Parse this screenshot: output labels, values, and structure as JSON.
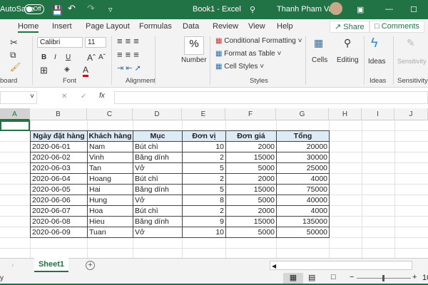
{
  "titlebar": {
    "autosave": "AutoSave",
    "toggle": "Off",
    "title": "Book1  -  Excel",
    "user": "Thanh Pham Van"
  },
  "tabs": [
    "Home",
    "Insert",
    "Page Layout",
    "Formulas",
    "Data",
    "Review",
    "View",
    "Help"
  ],
  "share": "Share",
  "comments": "Comments",
  "ribbon": {
    "font_name": "Calibri",
    "font_size": "11",
    "bold": "B",
    "italic": "I",
    "underline": "U",
    "grow": "Aˆ",
    "shrink": "Aˇ",
    "number": "Number",
    "number_icon": "%",
    "cond": "Conditional Formatting",
    "fmt_table": "Format as Table",
    "cell_styles": "Cell Styles",
    "cells": "Cells",
    "editing": "Editing",
    "ideas": "Ideas",
    "sensitivity": "Sensitivity",
    "groups": {
      "clipboard": "board",
      "font": "Font",
      "alignment": "Alignment",
      "styles": "Styles",
      "ideas": "Ideas",
      "sensitivity": "Sensitivity"
    }
  },
  "formula": {
    "cancel": "✕",
    "enter": "✓",
    "fx": "fx"
  },
  "columns": [
    "A",
    "B",
    "C",
    "D",
    "E",
    "F",
    "G",
    "H",
    "I",
    "J"
  ],
  "table": {
    "headers": [
      "Ngày đặt hàng",
      "Khách hàng",
      "Mục",
      "Đơn vị",
      "Đơn giá",
      "Tổng"
    ],
    "rows": [
      [
        "2020-06-01",
        "Nam",
        "Bút chì",
        "10",
        "2000",
        "20000"
      ],
      [
        "2020-06-02",
        "Vinh",
        "Băng dính",
        "2",
        "15000",
        "30000"
      ],
      [
        "2020-06-03",
        "Tan",
        "Vở",
        "5",
        "5000",
        "25000"
      ],
      [
        "2020-06-04",
        "Hoang",
        "Bút chì",
        "2",
        "2000",
        "4000"
      ],
      [
        "2020-06-05",
        "Hai",
        "Băng dính",
        "5",
        "15000",
        "75000"
      ],
      [
        "2020-06-06",
        "Hung",
        "Vở",
        "8",
        "5000",
        "40000"
      ],
      [
        "2020-06-07",
        "Hoa",
        "Bút chì",
        "2",
        "2000",
        "4000"
      ],
      [
        "2020-06-08",
        "Hieu",
        "Băng dính",
        "9",
        "15000",
        "135000"
      ],
      [
        "2020-06-09",
        "Tuan",
        "Vở",
        "10",
        "5000",
        "50000"
      ]
    ]
  },
  "sheet": {
    "name": "Sheet1",
    "add": "+"
  },
  "status": {
    "ready": "y",
    "zoom": "10"
  },
  "colors": {
    "brand": "#217346",
    "header_fill": "#ddebf7"
  }
}
